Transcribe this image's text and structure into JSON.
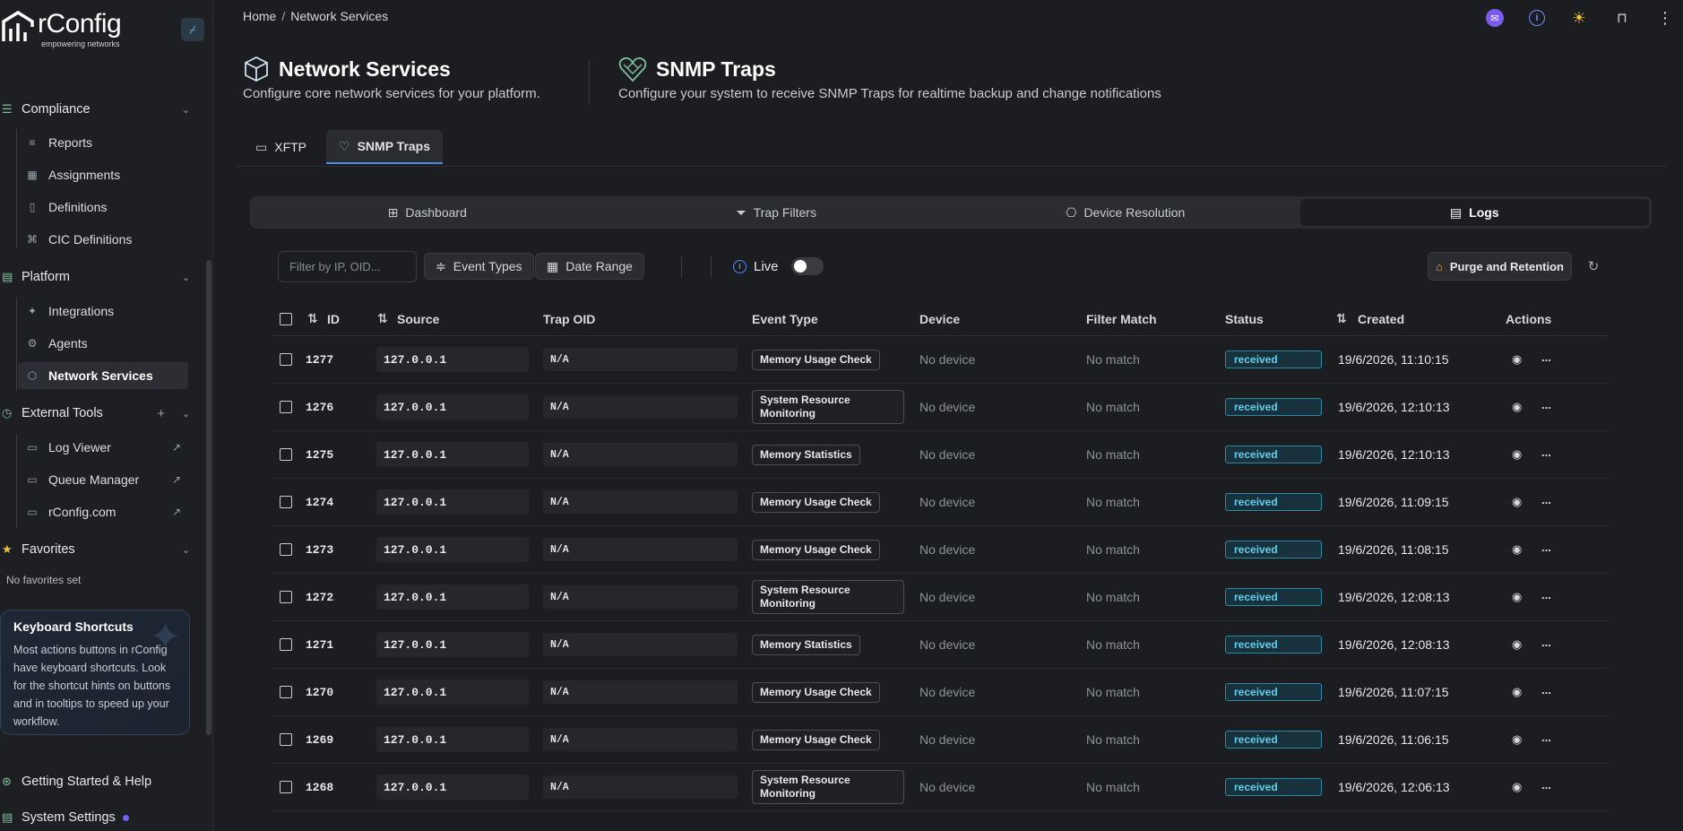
{
  "brand": {
    "name": "rConfig",
    "tagline": "empowering networks"
  },
  "sidebar": {
    "compliance": {
      "label": "Compliance",
      "items": [
        {
          "label": "Reports"
        },
        {
          "label": "Assignments"
        },
        {
          "label": "Definitions"
        },
        {
          "label": "CIC Definitions"
        }
      ]
    },
    "platform": {
      "label": "Platform",
      "items": [
        {
          "label": "Integrations"
        },
        {
          "label": "Agents"
        },
        {
          "label": "Network Services"
        }
      ]
    },
    "external_tools": {
      "label": "External Tools",
      "items": [
        {
          "label": "Log Viewer"
        },
        {
          "label": "Queue Manager"
        },
        {
          "label": "rConfig.com"
        }
      ]
    },
    "favorites": {
      "label": "Favorites",
      "empty": "No favorites set"
    },
    "shortcut_card": {
      "title": "Keyboard Shortcuts",
      "body": "Most actions buttons in rConfig have keyboard shortcuts. Look for the shortcut hints on buttons and in tooltips to speed up your workflow."
    },
    "getting_started": "Getting Started & Help",
    "system_settings": "System Settings"
  },
  "breadcrumb": {
    "home": "Home",
    "sep": "/",
    "current": "Network Services"
  },
  "header": {
    "left": {
      "title": "Network Services",
      "subtitle": "Configure core network services for your platform."
    },
    "right": {
      "title": "SNMP Traps",
      "subtitle": "Configure your system to receive SNMP Traps for realtime backup and change notifications"
    }
  },
  "tabs": [
    {
      "label": "XFTP"
    },
    {
      "label": "SNMP Traps"
    }
  ],
  "subtabs": [
    {
      "label": "Dashboard"
    },
    {
      "label": "Trap Filters"
    },
    {
      "label": "Device Resolution"
    },
    {
      "label": "Logs"
    }
  ],
  "toolbar": {
    "filter_placeholder": "Filter by IP, OID...",
    "event_types": "Event Types",
    "date_range": "Date Range",
    "live": "Live",
    "purge": "Purge and Retention"
  },
  "table": {
    "columns": [
      "ID",
      "Source",
      "Trap OID",
      "Event Type",
      "Device",
      "Filter Match",
      "Status",
      "Created",
      "Actions"
    ],
    "rows": [
      {
        "id": "1277",
        "source": "127.0.0.1",
        "oid": "N/A",
        "event": "Memory Usage Check",
        "device": "No device",
        "match": "No match",
        "status": "received",
        "created": "19/6/2026, 11:10:15"
      },
      {
        "id": "1276",
        "source": "127.0.0.1",
        "oid": "N/A",
        "event": "System Resource Monitoring",
        "device": "No device",
        "match": "No match",
        "status": "received",
        "created": "19/6/2026, 12:10:13"
      },
      {
        "id": "1275",
        "source": "127.0.0.1",
        "oid": "N/A",
        "event": "Memory Statistics",
        "device": "No device",
        "match": "No match",
        "status": "received",
        "created": "19/6/2026, 12:10:13"
      },
      {
        "id": "1274",
        "source": "127.0.0.1",
        "oid": "N/A",
        "event": "Memory Usage Check",
        "device": "No device",
        "match": "No match",
        "status": "received",
        "created": "19/6/2026, 11:09:15"
      },
      {
        "id": "1273",
        "source": "127.0.0.1",
        "oid": "N/A",
        "event": "Memory Usage Check",
        "device": "No device",
        "match": "No match",
        "status": "received",
        "created": "19/6/2026, 11:08:15"
      },
      {
        "id": "1272",
        "source": "127.0.0.1",
        "oid": "N/A",
        "event": "System Resource Monitoring",
        "device": "No device",
        "match": "No match",
        "status": "received",
        "created": "19/6/2026, 12:08:13"
      },
      {
        "id": "1271",
        "source": "127.0.0.1",
        "oid": "N/A",
        "event": "Memory Statistics",
        "device": "No device",
        "match": "No match",
        "status": "received",
        "created": "19/6/2026, 12:08:13"
      },
      {
        "id": "1270",
        "source": "127.0.0.1",
        "oid": "N/A",
        "event": "Memory Usage Check",
        "device": "No device",
        "match": "No match",
        "status": "received",
        "created": "19/6/2026, 11:07:15"
      },
      {
        "id": "1269",
        "source": "127.0.0.1",
        "oid": "N/A",
        "event": "Memory Usage Check",
        "device": "No device",
        "match": "No match",
        "status": "received",
        "created": "19/6/2026, 11:06:15"
      },
      {
        "id": "1268",
        "source": "127.0.0.1",
        "oid": "N/A",
        "event": "System Resource Monitoring",
        "device": "No device",
        "match": "No match",
        "status": "received",
        "created": "19/6/2026, 12:06:13"
      }
    ]
  },
  "icons": {
    "top": [
      "announcement-icon",
      "info-icon",
      "sun-icon",
      "inbox-icon",
      "more-vertical-icon"
    ]
  },
  "colors": {
    "accent": "#4c8ce6",
    "status_received": "#5fd0ee",
    "brand_green": "#7fc0a0",
    "purge_icon": "#f0a830"
  }
}
